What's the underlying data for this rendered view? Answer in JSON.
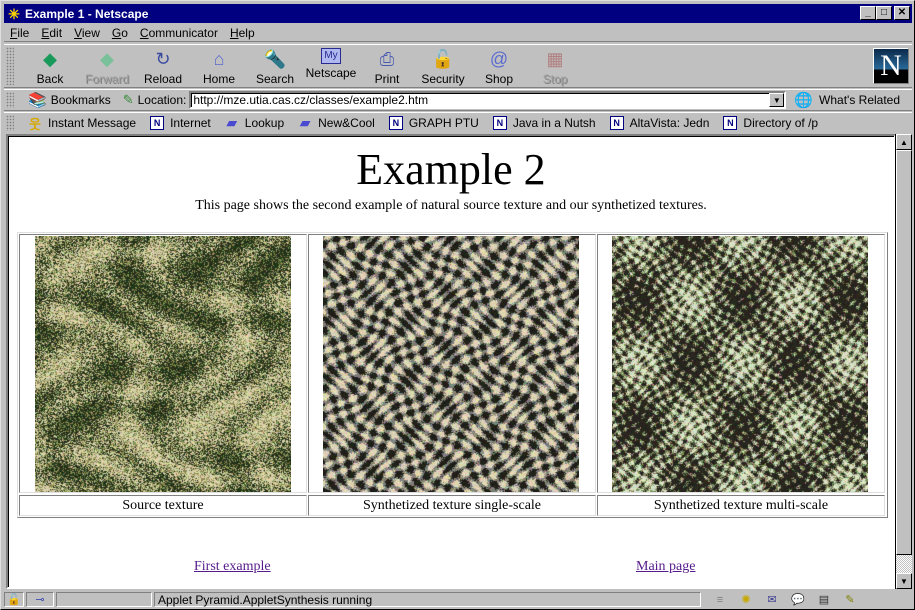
{
  "window": {
    "title": "Example 1 - Netscape",
    "buttons": [
      "minimize",
      "maximize",
      "close"
    ]
  },
  "menubar": [
    {
      "label": "File",
      "accel": "F"
    },
    {
      "label": "Edit",
      "accel": "E"
    },
    {
      "label": "View",
      "accel": "V"
    },
    {
      "label": "Go",
      "accel": "G"
    },
    {
      "label": "Communicator",
      "accel": "C"
    },
    {
      "label": "Help",
      "accel": "H"
    }
  ],
  "toolbar": {
    "buttons": [
      {
        "label": "Back",
        "icon": "back-arrow-icon",
        "enabled": true
      },
      {
        "label": "Forward",
        "icon": "forward-arrow-icon",
        "enabled": false
      },
      {
        "label": "Reload",
        "icon": "reload-icon",
        "enabled": true
      },
      {
        "label": "Home",
        "icon": "home-icon",
        "enabled": true
      },
      {
        "label": "Search",
        "icon": "search-flashlight-icon",
        "enabled": true
      },
      {
        "label": "Netscape",
        "icon": "my-netscape-icon",
        "enabled": true
      },
      {
        "label": "Print",
        "icon": "printer-icon",
        "enabled": true
      },
      {
        "label": "Security",
        "icon": "padlock-icon",
        "enabled": true
      },
      {
        "label": "Shop",
        "icon": "shopping-bag-icon",
        "enabled": true
      },
      {
        "label": "Stop",
        "icon": "stop-icon",
        "enabled": false
      }
    ],
    "logo": "N"
  },
  "location_bar": {
    "bookmarks_label": "Bookmarks",
    "location_label": "Location:",
    "url": "http://mze.utia.cas.cz/classes/example2.htm",
    "whats_related_label": "What's Related"
  },
  "personal_toolbar": [
    {
      "label": "Instant Message",
      "icon": "instant-message-icon"
    },
    {
      "label": "Internet",
      "icon": "netscape-page-icon"
    },
    {
      "label": "Lookup",
      "icon": "folder-icon"
    },
    {
      "label": "New&Cool",
      "icon": "folder-icon"
    },
    {
      "label": "GRAPH PTU",
      "icon": "netscape-page-icon"
    },
    {
      "label": "Java in a Nutsh",
      "icon": "netscape-page-icon"
    },
    {
      "label": "AltaVista: Jedn",
      "icon": "netscape-page-icon"
    },
    {
      "label": "Directory of /p",
      "icon": "netscape-page-icon"
    }
  ],
  "page": {
    "heading": "Example 2",
    "intro": "This page shows the second example of natural source texture and our synthetized textures.",
    "textures": [
      {
        "caption": "Source texture",
        "style": "source"
      },
      {
        "caption": "Synthetized texture single-scale",
        "style": "single"
      },
      {
        "caption": "Synthetized texture multi-scale",
        "style": "multi"
      }
    ],
    "links": [
      {
        "label": "First example"
      },
      {
        "label": "Main page"
      }
    ],
    "link_color": "#551a8b"
  },
  "status_bar": {
    "text": "Applet Pyramid.AppletSynthesis running"
  }
}
